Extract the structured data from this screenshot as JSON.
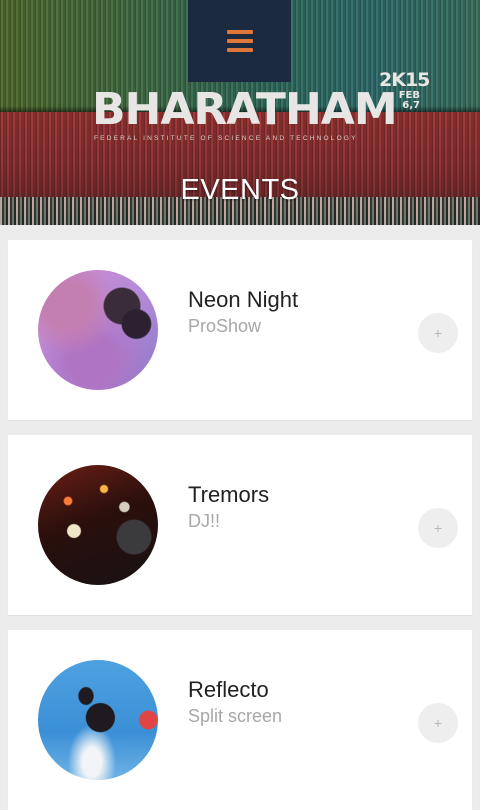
{
  "header": {
    "menu_icon": "hamburger-menu-icon",
    "logo": {
      "name": "BHARATHAM",
      "tagline": "FEDERAL INSTITUTE OF SCIENCE AND TECHNOLOGY",
      "year": "2K15",
      "date_month": "FEB",
      "date_days": "6,7"
    },
    "title": "EVENTS"
  },
  "events": [
    {
      "name": "Neon Night",
      "category": "ProShow",
      "add_label": "+",
      "image": "singer-with-microphone"
    },
    {
      "name": "Tremors",
      "category": "DJ!!",
      "add_label": "+",
      "image": "dj-mixing-deck"
    },
    {
      "name": "Reflecto",
      "category": "Split screen",
      "add_label": "+",
      "image": "leaping-dancer"
    }
  ],
  "colors": {
    "accent": "#e0773a",
    "menu_bg": "#1c2a3f",
    "card_bg": "#ffffff",
    "page_bg": "#ececec",
    "title_text": "#222222",
    "subtitle_text": "#a7a7a7"
  }
}
